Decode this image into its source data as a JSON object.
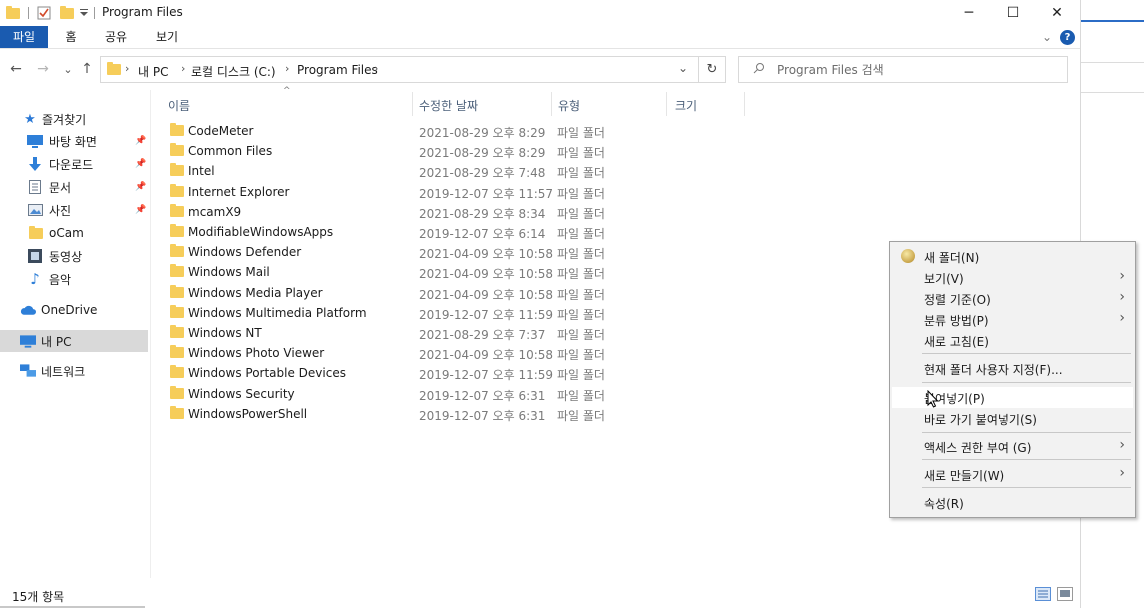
{
  "titlebar": {
    "title": "Program Files",
    "minimize": "─",
    "maximize": "☐",
    "close": "✕"
  },
  "ribbon": {
    "tabs": [
      "파일",
      "홈",
      "공유",
      "보기"
    ],
    "expand": "⌄",
    "help": "?"
  },
  "address": {
    "back": "←",
    "forward": "→",
    "recent": "⌄",
    "up": "↑",
    "crumbs": [
      "내 PC",
      "로컬 디스크 (C:)",
      "Program Files"
    ],
    "dropdown": "⌄",
    "refresh": "↻"
  },
  "search": {
    "placeholder": "Program Files 검색"
  },
  "sidebar": {
    "quick_access": "즐겨찾기",
    "items": [
      {
        "label": "바탕 화면",
        "icon": "desktop-icon",
        "pinned": true
      },
      {
        "label": "다운로드",
        "icon": "download-icon",
        "pinned": true
      },
      {
        "label": "문서",
        "icon": "document-icon",
        "pinned": true
      },
      {
        "label": "사진",
        "icon": "pictures-icon",
        "pinned": true
      },
      {
        "label": "oCam",
        "icon": "folder-icon",
        "pinned": false
      },
      {
        "label": "동영상",
        "icon": "videos-icon",
        "pinned": false
      },
      {
        "label": "음악",
        "icon": "music-icon",
        "pinned": false
      }
    ],
    "onedrive": "OneDrive",
    "this_pc": "내 PC",
    "network": "네트워크"
  },
  "columns": {
    "name": "이름",
    "date": "수정한 날짜",
    "type": "유형",
    "size": "크기"
  },
  "files": [
    {
      "name": "CodeMeter",
      "date": "2021-08-29 오후 8:29",
      "type": "파일 폴더"
    },
    {
      "name": "Common Files",
      "date": "2021-08-29 오후 8:29",
      "type": "파일 폴더"
    },
    {
      "name": "Intel",
      "date": "2021-08-29 오후 7:48",
      "type": "파일 폴더"
    },
    {
      "name": "Internet Explorer",
      "date": "2019-12-07 오후 11:57",
      "type": "파일 폴더"
    },
    {
      "name": "mcamX9",
      "date": "2021-08-29 오후 8:34",
      "type": "파일 폴더"
    },
    {
      "name": "ModifiableWindowsApps",
      "date": "2019-12-07 오후 6:14",
      "type": "파일 폴더"
    },
    {
      "name": "Windows Defender",
      "date": "2021-04-09 오후 10:58",
      "type": "파일 폴더"
    },
    {
      "name": "Windows Mail",
      "date": "2021-04-09 오후 10:58",
      "type": "파일 폴더"
    },
    {
      "name": "Windows Media Player",
      "date": "2021-04-09 오후 10:58",
      "type": "파일 폴더"
    },
    {
      "name": "Windows Multimedia Platform",
      "date": "2019-12-07 오후 11:59",
      "type": "파일 폴더"
    },
    {
      "name": "Windows NT",
      "date": "2021-08-29 오후 7:37",
      "type": "파일 폴더"
    },
    {
      "name": "Windows Photo Viewer",
      "date": "2021-04-09 오후 10:58",
      "type": "파일 폴더"
    },
    {
      "name": "Windows Portable Devices",
      "date": "2019-12-07 오후 11:59",
      "type": "파일 폴더"
    },
    {
      "name": "Windows Security",
      "date": "2019-12-07 오후 6:31",
      "type": "파일 폴더"
    },
    {
      "name": "WindowsPowerShell",
      "date": "2019-12-07 오후 6:31",
      "type": "파일 폴더"
    }
  ],
  "status": {
    "item_count": "15개 항목"
  },
  "context_menu": {
    "new_folder": "새 폴더(N)",
    "view": "보기(V)",
    "sort_by": "정렬 기준(O)",
    "group_by": "분류 방법(P)",
    "refresh": "새로 고침(E)",
    "customize": "현재 폴더 사용자 지정(F)...",
    "paste": "붙여넣기(P)",
    "paste_shortcut": "바로 가기 붙여넣기(S)",
    "give_access": "액세스 권한 부여 (G)",
    "new": "새로 만들기(W)",
    "properties": "속성(R)",
    "submenu_arrow": "›"
  },
  "colors": {
    "accent": "#1a5bb0",
    "folder": "#f6cd5a",
    "selected_nav": "#d9d9d9",
    "menu_bg": "#f2f2f2"
  }
}
